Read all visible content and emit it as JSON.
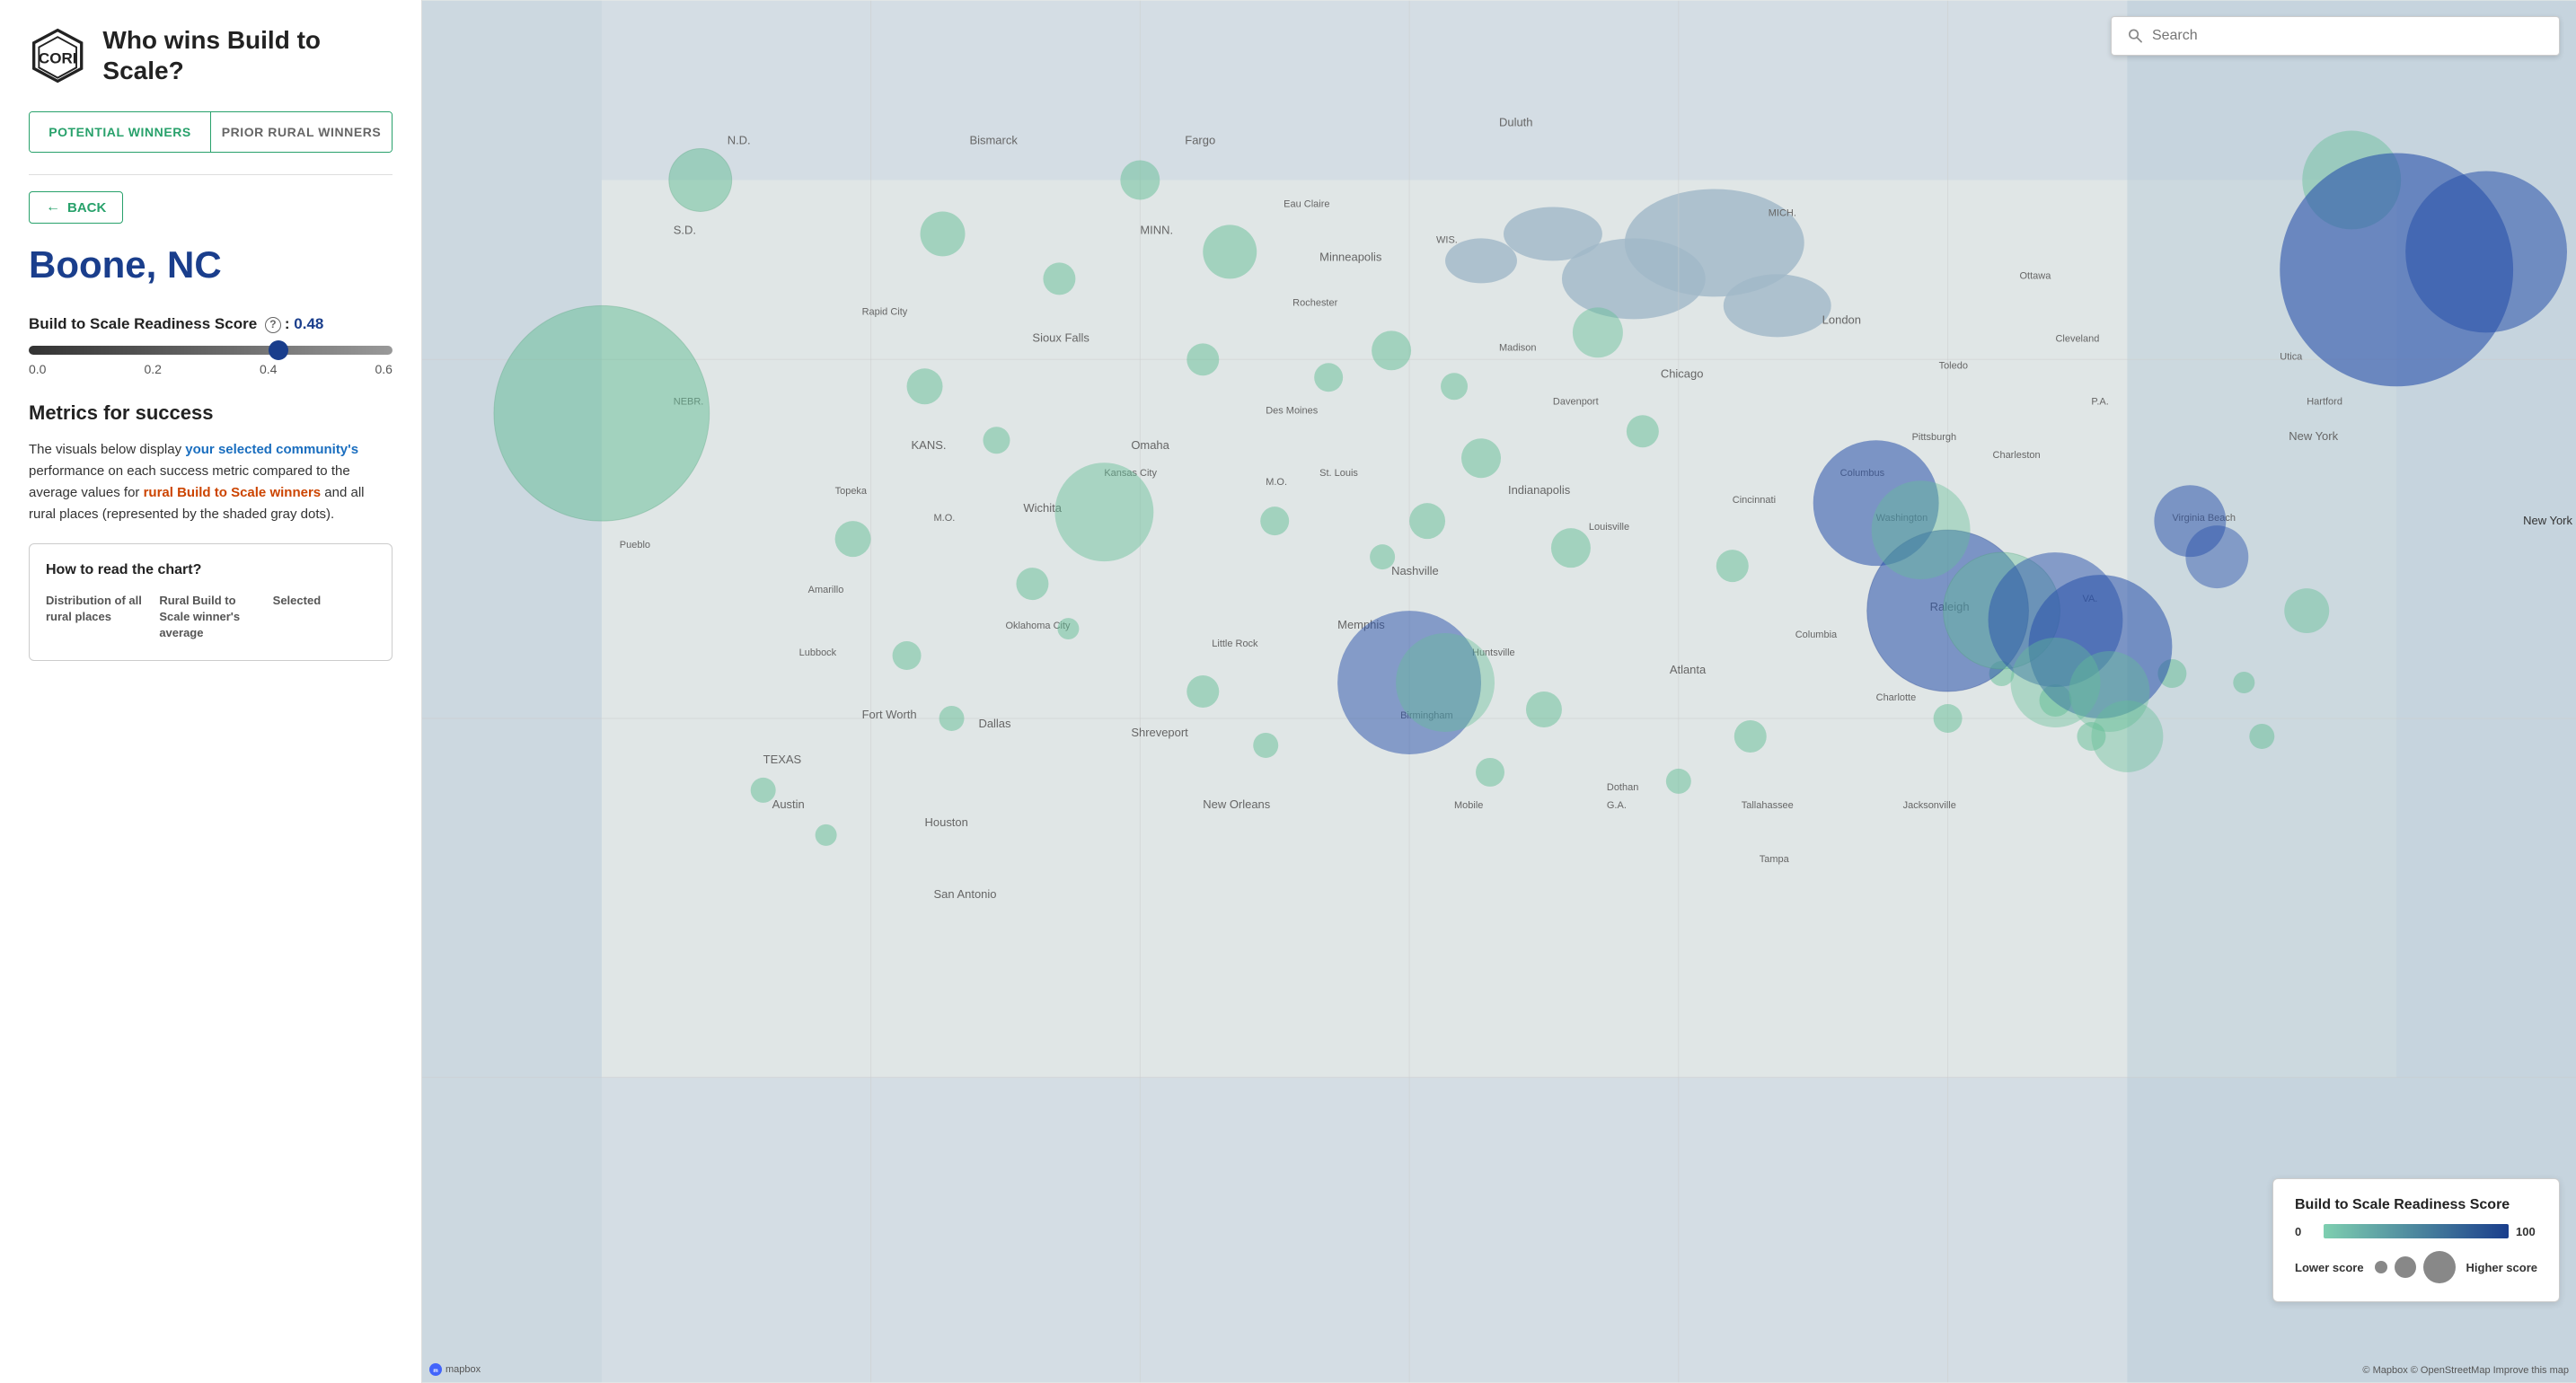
{
  "app": {
    "title": "Who wins Build to Scale?"
  },
  "tabs": {
    "tab1_label": "POTENTIAL WINNERS",
    "tab2_label": "PRIOR RURAL WINNERS"
  },
  "back_button": {
    "label": "BACK"
  },
  "city": {
    "name": "Boone, NC"
  },
  "score": {
    "label": "Build to Scale Readiness Score",
    "help": "?",
    "value": "0.48",
    "min": "0.0",
    "tick1": "0.2",
    "tick2": "0.4",
    "tick3": "0.6"
  },
  "metrics": {
    "section_title": "Metrics for success",
    "desc_part1": "The visuals below display ",
    "desc_community_link": "your selected community's",
    "desc_part2": " performance on each success metric compared to the average values for ",
    "desc_rural_link": "rural Build to Scale winners",
    "desc_part3": " and all rural places (represented by the shaded gray dots).",
    "chart_info_title": "How to read the chart?",
    "col1_label": "Distribution of all rural places",
    "col2_label": "Rural Build to Scale winner's average",
    "col3_label": "Selected"
  },
  "map": {
    "search_placeholder": "Search",
    "legend_title": "Build to Scale Readiness Score",
    "legend_min": "0",
    "legend_max": "100",
    "legend_size_low": "Lower score",
    "legend_size_high": "Higher score",
    "attribution": "© Mapbox © OpenStreetMap  Improve this map",
    "mapbox_logo": "mapbox",
    "new_york_label": "New York"
  },
  "colors": {
    "green_accent": "#28a16b",
    "blue_dark": "#1a3e8c",
    "circle_green": "rgba(100,190,150,0.55)",
    "circle_blue": "rgba(40,80,170,0.60)",
    "circle_gray": "rgba(130,130,130,0.35)"
  }
}
